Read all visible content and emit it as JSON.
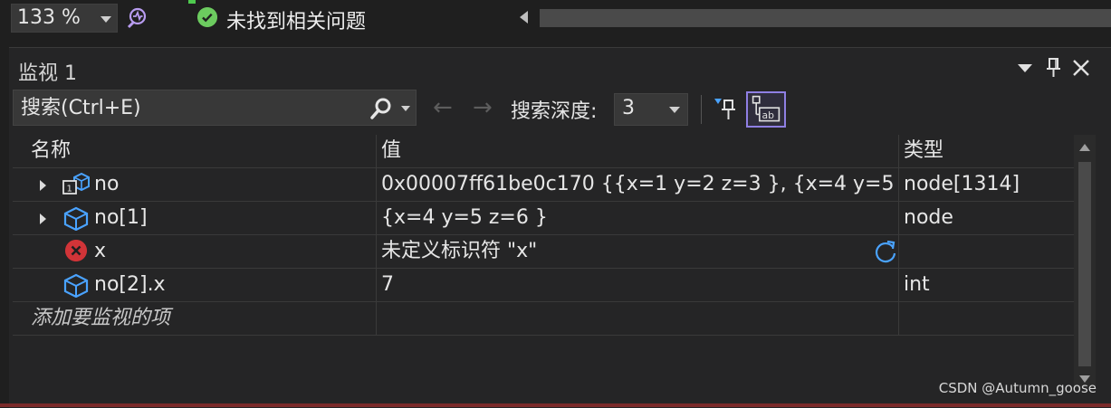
{
  "topbar": {
    "zoom": "133 %",
    "status_text": "未找到相关问题"
  },
  "panel": {
    "title": "监视 1",
    "search_placeholder": "搜索(Ctrl+E)",
    "back_arrow": "←",
    "forward_arrow": "→",
    "depth_label": "搜索深度:",
    "depth_value": "3"
  },
  "grid": {
    "headers": {
      "name": "名称",
      "value": "值",
      "type": "类型"
    },
    "rows": [
      {
        "name": "no",
        "value": "0x00007ff61be0c170 {{x=1 y=2 z=3 }, {x=4 y=5 ...",
        "type": "node[1314]",
        "icon": "array-object-icon",
        "expandable": true
      },
      {
        "name": "no[1]",
        "value": "{x=4 y=5 z=6 }",
        "type": "node",
        "icon": "object-icon",
        "expandable": true
      },
      {
        "name": "x",
        "value": "未定义标识符 \"x\"",
        "type": "",
        "icon": "error-icon",
        "expandable": false
      },
      {
        "name": "no[2].x",
        "value": "7",
        "type": "int",
        "icon": "object-icon",
        "expandable": false
      }
    ],
    "add_item": "添加要监视的项"
  },
  "watermark": "CSDN @Autumn_goose",
  "colors": {
    "background": "#1f1f1f",
    "panel": "#252526",
    "accent": "#8f7fe3",
    "object_icon": "#4aa3ff",
    "error": "#d13438",
    "ok": "#6ccb5f"
  }
}
